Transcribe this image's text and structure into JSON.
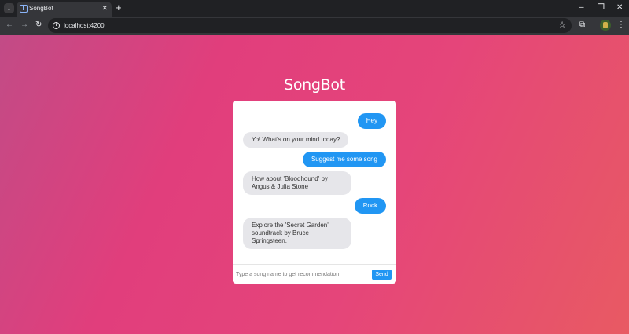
{
  "browser": {
    "tab_title": "SongBot",
    "url": "localhost:4200",
    "icons": {
      "tab_menu": "chevron-down-icon",
      "back": "arrow-left-icon",
      "forward": "arrow-right-icon",
      "reload": "reload-icon",
      "site_info": "info-icon",
      "bookmark": "star-icon",
      "extensions": "puzzle-icon",
      "menu": "kebab-menu-icon"
    }
  },
  "app": {
    "title": "SongBot",
    "messages": [
      {
        "sender": "user",
        "text": "Hey"
      },
      {
        "sender": "bot",
        "text": "Yo! What's on your mind today?"
      },
      {
        "sender": "user",
        "text": "Suggest me some song"
      },
      {
        "sender": "bot",
        "text": "How about 'Bloodhound' by Angus & Julia Stone"
      },
      {
        "sender": "user",
        "text": "Rock"
      },
      {
        "sender": "bot",
        "text": "Explore the 'Secret Garden' soundtrack by Bruce Springsteen."
      }
    ],
    "input": {
      "placeholder": "Type a song name to get recommendation",
      "value": ""
    },
    "send_label": "Send"
  },
  "colors": {
    "user_bubble": "#2196f3",
    "bot_bubble": "#e6e6ea",
    "background_start": "#c24b86",
    "background_end": "#e85a63"
  }
}
